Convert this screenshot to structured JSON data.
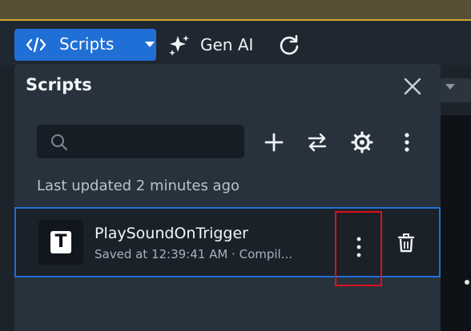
{
  "toolbar": {
    "scripts_button_label": "Scripts",
    "gen_ai_label": "Gen AI",
    "icons": [
      "code-icon",
      "chevron-down-icon",
      "sparkle-icon",
      "refresh-icon"
    ]
  },
  "panel": {
    "title": "Scripts",
    "search_placeholder": "",
    "last_updated": "Last updated 2 minutes ago",
    "tools": [
      "add-icon",
      "swap-icon",
      "settings-icon",
      "more-vertical-icon"
    ],
    "scripts": [
      {
        "icon_letter": "T",
        "name": "PlaySoundOnTrigger",
        "status": "Saved at 12:39:41 AM · Compil..."
      }
    ]
  },
  "colors": {
    "accent": "#1f6fd6",
    "highlight_box": "#e0101a",
    "panel_bg": "#28323d",
    "top_strip_border": "#d4a62a"
  }
}
